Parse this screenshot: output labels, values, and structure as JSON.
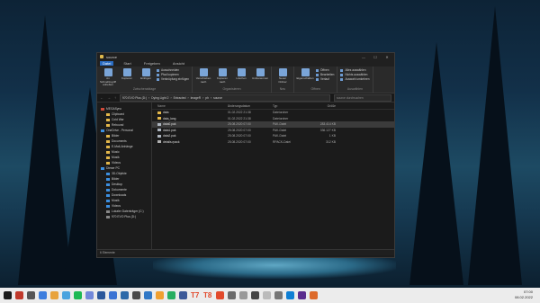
{
  "window": {
    "title": "source"
  },
  "ribbon_tabs": [
    "Datei",
    "Start",
    "Freigeben",
    "Ansicht"
  ],
  "ribbon": {
    "groups": [
      {
        "caption": "Zwischenablage",
        "big": [
          "An Schnellzugriff anheften",
          "Kopieren",
          "Einfügen"
        ],
        "small": [
          "Ausschneiden",
          "Pfad kopieren",
          "Verknüpfung einfügen"
        ]
      },
      {
        "caption": "Organisieren",
        "big": [
          "Verschieben nach",
          "Kopieren nach",
          "Löschen",
          "Umbenennen"
        ],
        "small": []
      },
      {
        "caption": "Neu",
        "big": [
          "Neuer Ordner"
        ],
        "small": []
      },
      {
        "caption": "Öffnen",
        "big": [
          "Eigenschaften"
        ],
        "small": [
          "Öffnen",
          "Bearbeiten",
          "Verlauf"
        ]
      },
      {
        "caption": "Auswählen",
        "big": [],
        "small": [
          "Alles auswählen",
          "Nichts auswählen",
          "Auswahl umkehren"
        ]
      }
    ]
  },
  "address": {
    "crumbs": [
      "970 EVO Plus (D:)",
      "Dying Light 2",
      "Extracted",
      "ImageR",
      "ph",
      "source"
    ],
    "search_placeholder": "source durchsuchen"
  },
  "sidebar": [
    {
      "label": "MEGASync",
      "icon": "red",
      "indent": false
    },
    {
      "label": "Clipboard",
      "icon": "folder",
      "indent": true
    },
    {
      "label": "Cold War",
      "icon": "folder",
      "indent": true
    },
    {
      "label": "Rebound",
      "icon": "folder",
      "indent": true
    },
    {
      "label": "OneDrive - Personal",
      "icon": "blue",
      "indent": false
    },
    {
      "label": "Bilder",
      "icon": "folder",
      "indent": true
    },
    {
      "label": "Documents",
      "icon": "folder",
      "indent": true
    },
    {
      "label": "E-Mail-Anhänge",
      "icon": "folder",
      "indent": true
    },
    {
      "label": "Music",
      "icon": "folder",
      "indent": true
    },
    {
      "label": "Musik",
      "icon": "folder",
      "indent": true
    },
    {
      "label": "Videos",
      "icon": "folder",
      "indent": true
    },
    {
      "label": "Dieser PC",
      "icon": "blue",
      "indent": false
    },
    {
      "label": "3D-Objekte",
      "icon": "blue",
      "indent": true
    },
    {
      "label": "Bilder",
      "icon": "blue",
      "indent": true
    },
    {
      "label": "Desktop",
      "icon": "blue",
      "indent": true
    },
    {
      "label": "Dokumente",
      "icon": "blue",
      "indent": true
    },
    {
      "label": "Downloads",
      "icon": "blue",
      "indent": true
    },
    {
      "label": "Musik",
      "icon": "blue",
      "indent": true
    },
    {
      "label": "Videos",
      "icon": "blue",
      "indent": true
    },
    {
      "label": "Lokaler Datenträger (C:)",
      "icon": "gray",
      "indent": true
    },
    {
      "label": "970 EVO Plus (D:)",
      "icon": "gray",
      "indent": true
    }
  ],
  "columns": [
    "Name",
    "Änderungsdatum",
    "Typ",
    "Größe"
  ],
  "files": [
    {
      "name": "data",
      "date": "01.02.2022 21:38",
      "type": "Dateiordner",
      "size": "",
      "icon": "folder",
      "selected": false
    },
    {
      "name": "data_lang",
      "date": "01.02.2022 21:38",
      "type": "Dateiordner",
      "size": "",
      "icon": "folder",
      "selected": false
    },
    {
      "name": "data0.pak",
      "date": "25.08.2020 07:00",
      "type": "PAK-Datei",
      "size": "283.414 KB",
      "icon": "pak",
      "selected": true
    },
    {
      "name": "data1.pak",
      "date": "25.08.2020 07:00",
      "type": "PAK-Datei",
      "size": "336.127 KB",
      "icon": "pak",
      "selected": false
    },
    {
      "name": "data2.pak",
      "date": "25.08.2020 07:00",
      "type": "PAK-Datei",
      "size": "1 KB",
      "icon": "pak",
      "selected": false
    },
    {
      "name": "details.rpack",
      "date": "25.08.2020 07:00",
      "type": "RPACK-Datei",
      "size": "312 KB",
      "icon": "rpak",
      "selected": false
    }
  ],
  "status": {
    "text": "6 Elemente"
  },
  "taskbar": {
    "apps": [
      "#c0392b",
      "#555555",
      "#3d7ede",
      "#e8a33d",
      "#4aa3df",
      "#1db954",
      "#7289da",
      "#2b579a",
      "#3b73d4",
      "#2d6aa9",
      "#4a4a4a",
      "#3178c6",
      "#f0a030",
      "#27ae60",
      "#3b5998",
      "#e24a2c",
      "#e24a2c",
      "#e24a2c",
      "#6a6a6a",
      "#999999",
      "#444444",
      "#bbbbbb",
      "#777777",
      "#0f7fd4",
      "#5b2d8e",
      "#dd6a2a"
    ],
    "labels": {
      "t7": "T7",
      "t8": "T8"
    },
    "time": "07:00",
    "date": "08.02.2022"
  }
}
